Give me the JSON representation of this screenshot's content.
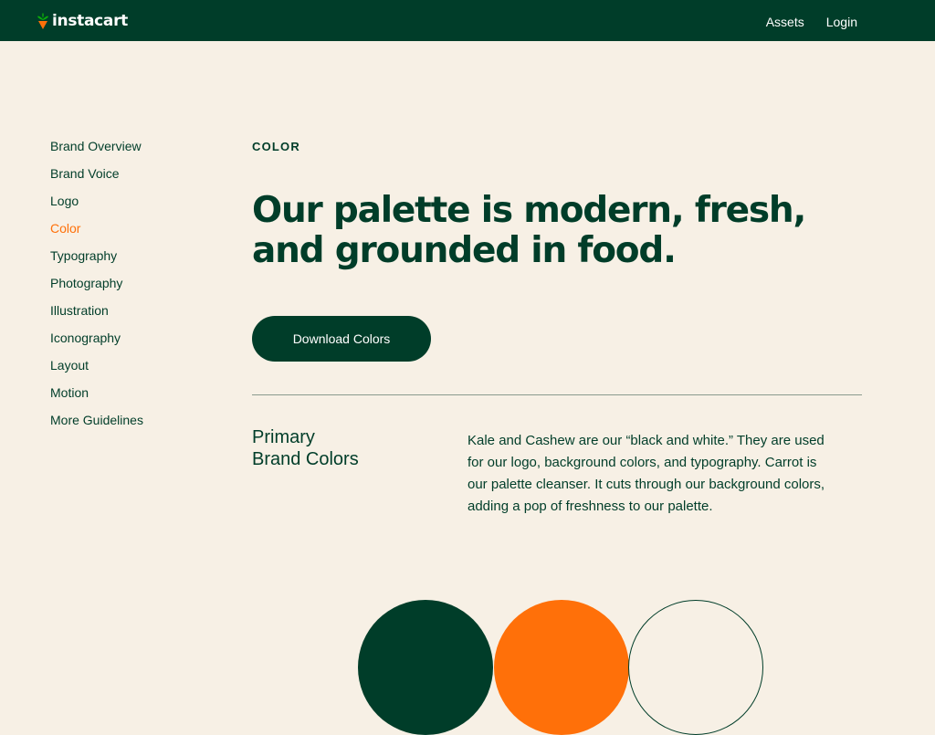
{
  "header": {
    "logo_text": "instacart",
    "nav": [
      {
        "label": "Assets"
      },
      {
        "label": "Login"
      }
    ]
  },
  "sidebar": {
    "items": [
      {
        "label": "Brand Overview",
        "active": false
      },
      {
        "label": "Brand Voice",
        "active": false
      },
      {
        "label": "Logo",
        "active": false
      },
      {
        "label": "Color",
        "active": true
      },
      {
        "label": "Typography",
        "active": false
      },
      {
        "label": "Photography",
        "active": false
      },
      {
        "label": "Illustration",
        "active": false
      },
      {
        "label": "Iconography",
        "active": false
      },
      {
        "label": "Layout",
        "active": false
      },
      {
        "label": "Motion",
        "active": false
      },
      {
        "label": "More Guidelines",
        "active": false
      }
    ]
  },
  "main": {
    "eyebrow": "COLOR",
    "headline": "Our palette is modern, fresh, and grounded in food.",
    "download_label": "Download Colors",
    "section_title_line1": "Primary",
    "section_title_line2": "Brand Colors",
    "section_body": "Kale and Cashew are our “black and white.” They are used for our logo, background colors, and typography. Carrot is our palette cleanser. It cuts through our background colors, adding a pop of freshness to our palette."
  },
  "colors": {
    "kale": "#003D29",
    "carrot": "#FF7009",
    "cashew": "#F7F0E5"
  }
}
